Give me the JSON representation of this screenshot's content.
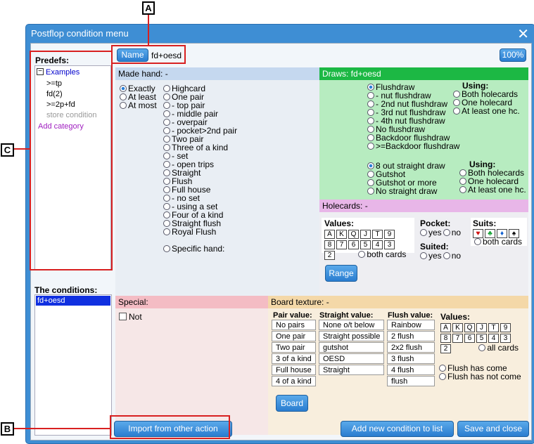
{
  "window": {
    "title": "Postflop condition menu",
    "close_glyph": "✕"
  },
  "callouts": {
    "a": "A",
    "b": "B",
    "c": "C"
  },
  "name": {
    "button": "Name",
    "value": "fd+oesd",
    "zoom": "100%"
  },
  "predefs": {
    "label": "Predefs:",
    "toggle": "−",
    "root": "Examples",
    "items": [
      ">=tp",
      "fd(2)",
      ">=2p+fd",
      "store condition"
    ],
    "add_category": "Add category"
  },
  "conditions": {
    "label": "The conditions:",
    "items": [
      "fd+oesd"
    ]
  },
  "made_hand": {
    "header": "Made hand:  -",
    "modes": [
      "Exactly",
      "At least",
      "At most"
    ],
    "options": [
      "Highcard",
      "One pair",
      "- top pair",
      "- middle pair",
      "- overpair",
      "- pocket>2nd pair",
      "Two pair",
      "Three of a kind",
      "- set",
      "- open trips",
      "Straight",
      "Flush",
      "Full house",
      "- no set",
      "- using a set",
      "Four of a kind",
      "Straight flush",
      "Royal Flush"
    ],
    "specific": "Specific hand:"
  },
  "draws": {
    "header": "Draws:  fd+oesd",
    "flush_options": [
      "Flushdraw",
      "- nut flushdraw",
      "- 2nd nut flushdraw",
      "- 3rd nut flushdraw",
      "- 4th nut flushdraw",
      "No flushdraw",
      "Backdoor flushdraw",
      ">=Backdoor flushdraw"
    ],
    "using_label": "Using:",
    "using1": [
      "Both holecards",
      "One holecard",
      "At least one hc."
    ],
    "straight_options": [
      "8 out straight draw",
      "Gutshot",
      "Gutshot or more",
      "No straight draw"
    ],
    "using2": [
      "Both holecards",
      "One holecard",
      "At least one hc."
    ]
  },
  "holecards": {
    "header": "Holecards:  -",
    "values_label": "Values:",
    "ranks_row1": [
      "A",
      "K",
      "Q",
      "J",
      "T",
      "9"
    ],
    "ranks_row2": [
      "8",
      "7",
      "6",
      "5",
      "4",
      "3"
    ],
    "ranks_row3": [
      "2"
    ],
    "both_cards": "both cards",
    "pocket_label": "Pocket:",
    "suited_label": "Suited:",
    "yes": "yes",
    "no": "no",
    "suits_label": "Suits:",
    "suits": [
      "♥",
      "♣",
      "♦",
      "♠"
    ],
    "suits_both": "both cards",
    "range_button": "Range"
  },
  "special": {
    "header": "Special:",
    "not_label": "Not"
  },
  "board": {
    "header": "Board texture:  -",
    "pair_label": "Pair value:",
    "pair_values": [
      "No pairs",
      "One pair",
      "Two pair",
      "3 of a kind",
      "Full house",
      "4 of a kind"
    ],
    "straight_label": "Straight value:",
    "straight_values": [
      "None o/t below",
      "Straight possible",
      "gutshot",
      "OESD",
      "Straight"
    ],
    "flush_label": "Flush value:",
    "flush_values": [
      "Rainbow",
      "2 flush",
      "2x2 flush",
      "3 flush",
      "4 flush",
      "flush"
    ],
    "values_label": "Values:",
    "all_cards": "all cards",
    "flush_come": "Flush has come",
    "flush_not_come": "Flush has not come",
    "board_button": "Board"
  },
  "footer": {
    "import": "Import from other action",
    "add": "Add new condition to list",
    "save": "Save and close"
  }
}
